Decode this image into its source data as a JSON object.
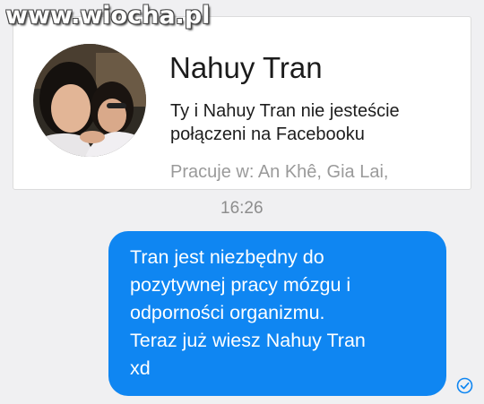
{
  "watermark": {
    "text": "www.wiocha.pl"
  },
  "profile": {
    "name": "Nahuy Tran",
    "connection_line_1": "Ty i Nahuy Tran nie jesteście",
    "connection_line_2": "połączeni na Facebooku",
    "work": "Pracuje w: An Khê, Gia Lai,",
    "avatar_icon": "profile-photo"
  },
  "timestamp": "16:26",
  "message": {
    "lines": [
      "Tran jest niezbędny do",
      "pozytywnej pracy mózgu i",
      "odporności organizmu.",
      "Teraz już wiesz Nahuy Tran",
      "xd"
    ],
    "bubble_color": "#0f86f2",
    "status_icon": "check-circle-icon"
  },
  "colors": {
    "background": "#f0f0f2",
    "card": "#ffffff",
    "secondary_text": "#9a9a9a"
  }
}
